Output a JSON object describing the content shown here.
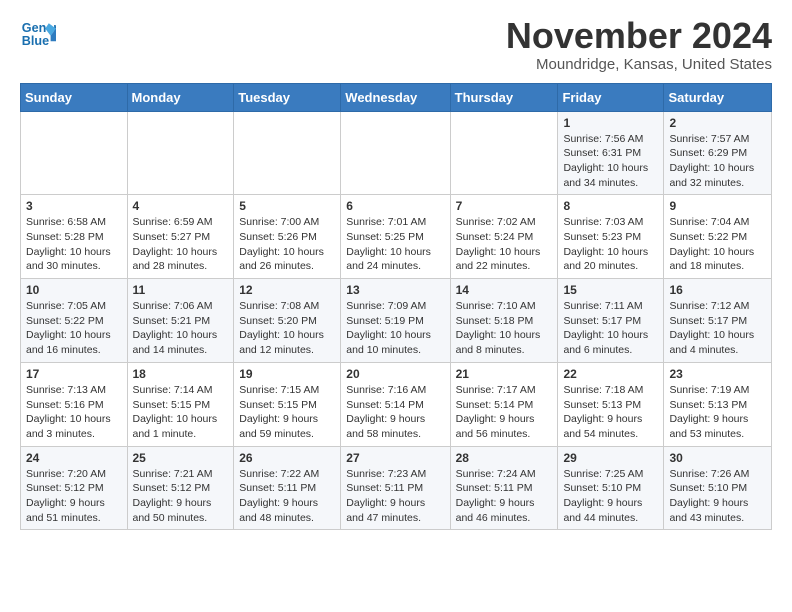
{
  "header": {
    "logo_line1": "General",
    "logo_line2": "Blue",
    "month": "November 2024",
    "location": "Moundridge, Kansas, United States"
  },
  "days_of_week": [
    "Sunday",
    "Monday",
    "Tuesday",
    "Wednesday",
    "Thursday",
    "Friday",
    "Saturday"
  ],
  "weeks": [
    [
      {
        "day": "",
        "content": ""
      },
      {
        "day": "",
        "content": ""
      },
      {
        "day": "",
        "content": ""
      },
      {
        "day": "",
        "content": ""
      },
      {
        "day": "",
        "content": ""
      },
      {
        "day": "1",
        "content": "Sunrise: 7:56 AM\nSunset: 6:31 PM\nDaylight: 10 hours and 34 minutes."
      },
      {
        "day": "2",
        "content": "Sunrise: 7:57 AM\nSunset: 6:29 PM\nDaylight: 10 hours and 32 minutes."
      }
    ],
    [
      {
        "day": "3",
        "content": "Sunrise: 6:58 AM\nSunset: 5:28 PM\nDaylight: 10 hours and 30 minutes."
      },
      {
        "day": "4",
        "content": "Sunrise: 6:59 AM\nSunset: 5:27 PM\nDaylight: 10 hours and 28 minutes."
      },
      {
        "day": "5",
        "content": "Sunrise: 7:00 AM\nSunset: 5:26 PM\nDaylight: 10 hours and 26 minutes."
      },
      {
        "day": "6",
        "content": "Sunrise: 7:01 AM\nSunset: 5:25 PM\nDaylight: 10 hours and 24 minutes."
      },
      {
        "day": "7",
        "content": "Sunrise: 7:02 AM\nSunset: 5:24 PM\nDaylight: 10 hours and 22 minutes."
      },
      {
        "day": "8",
        "content": "Sunrise: 7:03 AM\nSunset: 5:23 PM\nDaylight: 10 hours and 20 minutes."
      },
      {
        "day": "9",
        "content": "Sunrise: 7:04 AM\nSunset: 5:22 PM\nDaylight: 10 hours and 18 minutes."
      }
    ],
    [
      {
        "day": "10",
        "content": "Sunrise: 7:05 AM\nSunset: 5:22 PM\nDaylight: 10 hours and 16 minutes."
      },
      {
        "day": "11",
        "content": "Sunrise: 7:06 AM\nSunset: 5:21 PM\nDaylight: 10 hours and 14 minutes."
      },
      {
        "day": "12",
        "content": "Sunrise: 7:08 AM\nSunset: 5:20 PM\nDaylight: 10 hours and 12 minutes."
      },
      {
        "day": "13",
        "content": "Sunrise: 7:09 AM\nSunset: 5:19 PM\nDaylight: 10 hours and 10 minutes."
      },
      {
        "day": "14",
        "content": "Sunrise: 7:10 AM\nSunset: 5:18 PM\nDaylight: 10 hours and 8 minutes."
      },
      {
        "day": "15",
        "content": "Sunrise: 7:11 AM\nSunset: 5:17 PM\nDaylight: 10 hours and 6 minutes."
      },
      {
        "day": "16",
        "content": "Sunrise: 7:12 AM\nSunset: 5:17 PM\nDaylight: 10 hours and 4 minutes."
      }
    ],
    [
      {
        "day": "17",
        "content": "Sunrise: 7:13 AM\nSunset: 5:16 PM\nDaylight: 10 hours and 3 minutes."
      },
      {
        "day": "18",
        "content": "Sunrise: 7:14 AM\nSunset: 5:15 PM\nDaylight: 10 hours and 1 minute."
      },
      {
        "day": "19",
        "content": "Sunrise: 7:15 AM\nSunset: 5:15 PM\nDaylight: 9 hours and 59 minutes."
      },
      {
        "day": "20",
        "content": "Sunrise: 7:16 AM\nSunset: 5:14 PM\nDaylight: 9 hours and 58 minutes."
      },
      {
        "day": "21",
        "content": "Sunrise: 7:17 AM\nSunset: 5:14 PM\nDaylight: 9 hours and 56 minutes."
      },
      {
        "day": "22",
        "content": "Sunrise: 7:18 AM\nSunset: 5:13 PM\nDaylight: 9 hours and 54 minutes."
      },
      {
        "day": "23",
        "content": "Sunrise: 7:19 AM\nSunset: 5:13 PM\nDaylight: 9 hours and 53 minutes."
      }
    ],
    [
      {
        "day": "24",
        "content": "Sunrise: 7:20 AM\nSunset: 5:12 PM\nDaylight: 9 hours and 51 minutes."
      },
      {
        "day": "25",
        "content": "Sunrise: 7:21 AM\nSunset: 5:12 PM\nDaylight: 9 hours and 50 minutes."
      },
      {
        "day": "26",
        "content": "Sunrise: 7:22 AM\nSunset: 5:11 PM\nDaylight: 9 hours and 48 minutes."
      },
      {
        "day": "27",
        "content": "Sunrise: 7:23 AM\nSunset: 5:11 PM\nDaylight: 9 hours and 47 minutes."
      },
      {
        "day": "28",
        "content": "Sunrise: 7:24 AM\nSunset: 5:11 PM\nDaylight: 9 hours and 46 minutes."
      },
      {
        "day": "29",
        "content": "Sunrise: 7:25 AM\nSunset: 5:10 PM\nDaylight: 9 hours and 44 minutes."
      },
      {
        "day": "30",
        "content": "Sunrise: 7:26 AM\nSunset: 5:10 PM\nDaylight: 9 hours and 43 minutes."
      }
    ]
  ]
}
